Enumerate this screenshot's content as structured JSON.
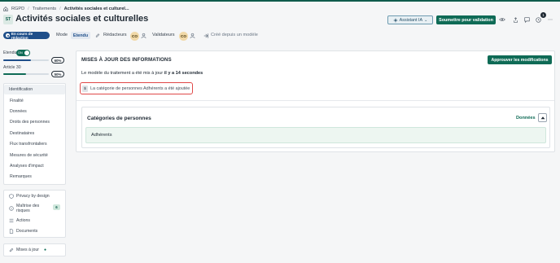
{
  "breadcrumb": {
    "items": [
      "RGPD",
      "Traitements",
      "Activités sociales et culturel..."
    ]
  },
  "header": {
    "badge": "ST",
    "title": "Activités sociales et culturelles",
    "ai_button": "Assistant IA",
    "submit_button": "Soumettre pour validation",
    "notification_count": "1"
  },
  "subheader": {
    "status": "En cours de rédaction",
    "mode_label": "Mode",
    "mode_value": "Etendu",
    "editors_label": "Rédacteurs",
    "editors_avatar": "CO",
    "validators_label": "Validateurs",
    "validators_avatar": "CO",
    "created_from": "Créé depuis un modèle"
  },
  "sidebar": {
    "scores": [
      {
        "label": "Etendu",
        "toggle": "ON",
        "percent": "60%",
        "fill": 0.6,
        "color": "#1f4f8a"
      },
      {
        "label": "Article 30",
        "percent": "50%",
        "fill": 0.5,
        "color": "#0f6b56"
      }
    ],
    "sections": [
      "Identification",
      "Finalité",
      "Données",
      "Droits des personnes",
      "Destinataires",
      "Flux transfrontaliers",
      "Mesures de sécurité",
      "Analyses d'impact",
      "Remarques"
    ],
    "tools": [
      {
        "label": "Privacy by design",
        "icon": "shield-icon"
      },
      {
        "label": "Maîtrise des risques",
        "icon": "info-icon",
        "count": "6"
      },
      {
        "label": "Actions",
        "icon": "list-icon"
      },
      {
        "label": "Documents",
        "icon": "document-icon"
      }
    ],
    "updates": {
      "label": "Mises à jour",
      "icon": "edit-icon"
    }
  },
  "updates_panel": {
    "title": "MISES À JOUR DES INFORMATIONS",
    "approve_button": "Approuver les modifications",
    "text_prefix": "Le modèle du traitement a été mis à jour",
    "text_time": "il y a 14 secondes",
    "change_icon": "$",
    "change_text": "La catégorie de personnes Adhérents a été ajoutée"
  },
  "categories": {
    "title": "Catégories de personnes",
    "link": "Données",
    "items": [
      "Adhérents"
    ]
  },
  "colors": {
    "primary": "#0f6b56",
    "status": "#1f4f8a",
    "highlight": "#e04848"
  }
}
